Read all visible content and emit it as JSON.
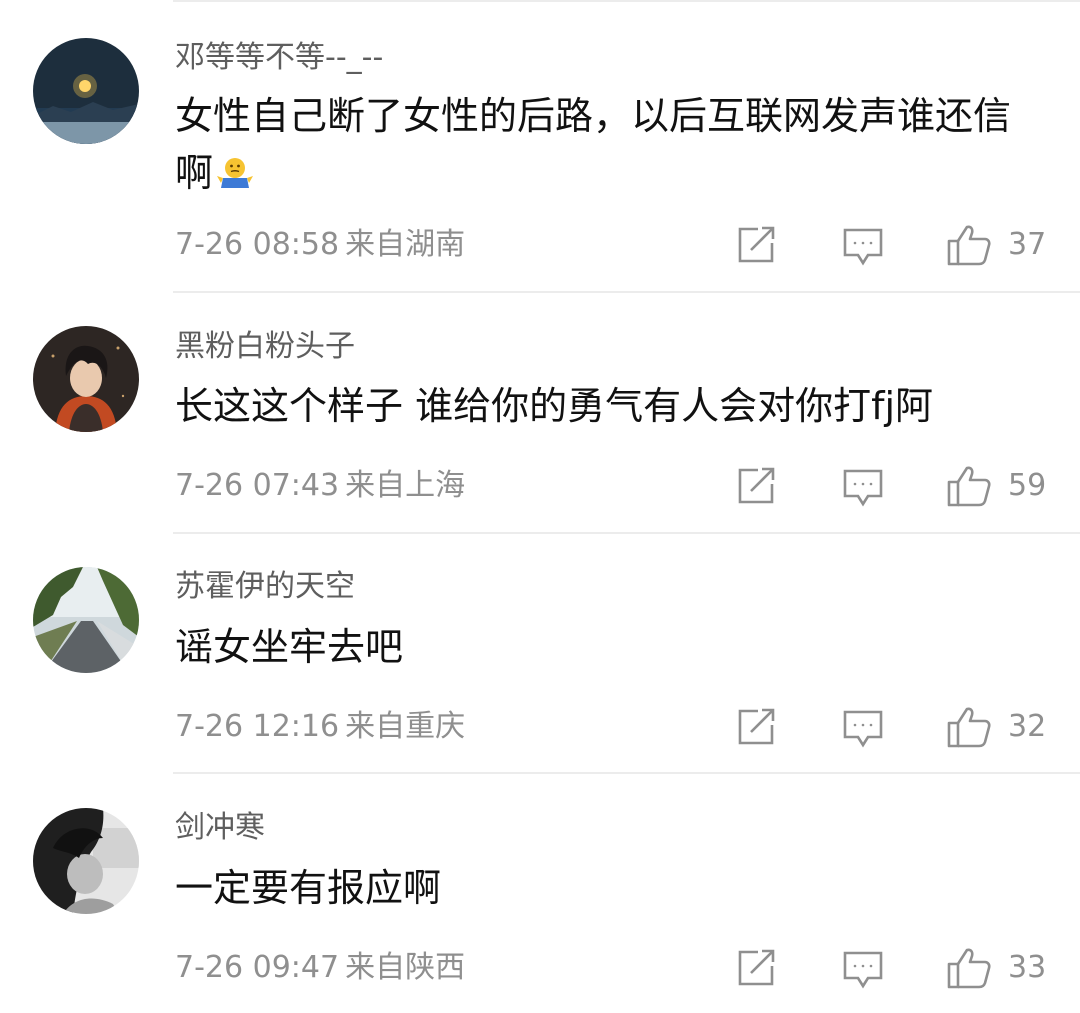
{
  "comments": [
    {
      "username": "邓等等不等--_--",
      "content": "女性自己断了女性的后路，以后互联网发声谁还信啊",
      "emoji": "shrug-emoji",
      "time": "7-26 08:58",
      "location": "来自湖南",
      "likes": "37"
    },
    {
      "username": "黑粉白粉头子",
      "content": "长这这个样子  谁给你的勇气有人会对你打fj阿",
      "time": "7-26 07:43",
      "location": "来自上海",
      "likes": "59"
    },
    {
      "username": "苏霍伊的天空",
      "content": "谣女坐牢去吧",
      "time": "7-26 12:16",
      "location": "来自重庆",
      "likes": "32"
    },
    {
      "username": "剑冲寒",
      "content": "一定要有报应啊",
      "time": "7-26 09:47",
      "location": "来自陕西",
      "likes": "33"
    }
  ],
  "icons": {
    "repost": "share-icon",
    "reply": "comment-icon",
    "like": "thumbs-up-icon"
  },
  "colors": {
    "text": "#111111",
    "username": "#5e5e5e",
    "meta": "#8f8f8f",
    "divider": "#ececec"
  }
}
